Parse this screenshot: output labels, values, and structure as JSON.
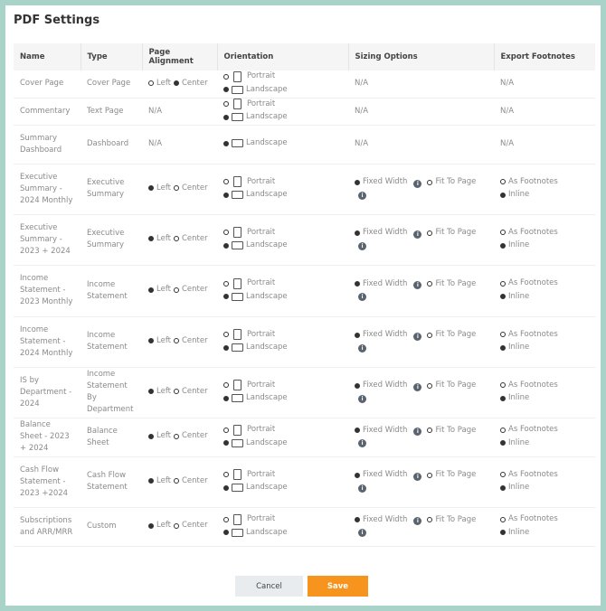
{
  "title": "PDF Settings",
  "columns": [
    "Name",
    "Type",
    "Page Alignment",
    "Orientation",
    "Sizing Options",
    "Export Footnotes"
  ],
  "labels": {
    "left": "Left",
    "center": "Center",
    "portrait": "Portrait",
    "landscape": "Landscape",
    "fixed": "Fixed Width",
    "fit": "Fit To Page",
    "footnotes": "As Footnotes",
    "inline": "Inline",
    "na": "N/A",
    "info": "i"
  },
  "rows": [
    {
      "name": "Cover Page",
      "type": "Cover Page",
      "align": "center",
      "orient": "landscape",
      "portrait": true,
      "sizing": null,
      "foot": null,
      "h": 30
    },
    {
      "name": "Commentary",
      "type": "Text Page",
      "align": null,
      "orient": "landscape",
      "portrait": true,
      "sizing": null,
      "foot": null,
      "h": 30
    },
    {
      "name": "Summary Dashboard",
      "type": "Dashboard",
      "align": null,
      "orient": "landscape",
      "portrait": false,
      "sizing": null,
      "foot": null,
      "h": 43
    },
    {
      "name": "Executive Summary - 2024 Monthly",
      "type": "Executive Summary",
      "align": "left",
      "orient": "landscape",
      "portrait": true,
      "sizing": "fixed",
      "foot": "inline",
      "h": 56
    },
    {
      "name": "Executive Summary - 2023 + 2024",
      "type": "Executive Summary",
      "align": "left",
      "orient": "landscape",
      "portrait": true,
      "sizing": "fixed",
      "foot": "inline",
      "h": 56
    },
    {
      "name": "Income Statement - 2023 Monthly",
      "type": "Income Statement",
      "align": "left",
      "orient": "landscape",
      "portrait": true,
      "sizing": "fixed",
      "foot": "inline",
      "h": 57
    },
    {
      "name": "Income Statement - 2024 Monthly",
      "type": "Income Statement",
      "align": "left",
      "orient": "landscape",
      "portrait": true,
      "sizing": "fixed",
      "foot": "inline",
      "h": 56
    },
    {
      "name": "IS by Department - 2024",
      "type": "Income Statement By Department",
      "align": "left",
      "orient": "landscape",
      "portrait": true,
      "sizing": "fixed",
      "foot": "inline",
      "h": 56
    },
    {
      "name": "Balance Sheet - 2023 + 2024",
      "type": "Balance Sheet",
      "align": "left",
      "orient": "landscape",
      "portrait": true,
      "sizing": "fixed",
      "foot": "inline",
      "h": 43
    },
    {
      "name": "Cash Flow Statement - 2023 +2024",
      "type": "Cash Flow Statement",
      "align": "left",
      "orient": "landscape",
      "portrait": true,
      "sizing": "fixed",
      "foot": "inline",
      "h": 56
    },
    {
      "name": "Subscriptions and ARR/MRR",
      "type": "Custom",
      "align": "left",
      "orient": "landscape",
      "portrait": true,
      "sizing": "fixed",
      "foot": "inline",
      "h": 43
    }
  ],
  "buttons": {
    "cancel": "Cancel",
    "save": "Save"
  }
}
